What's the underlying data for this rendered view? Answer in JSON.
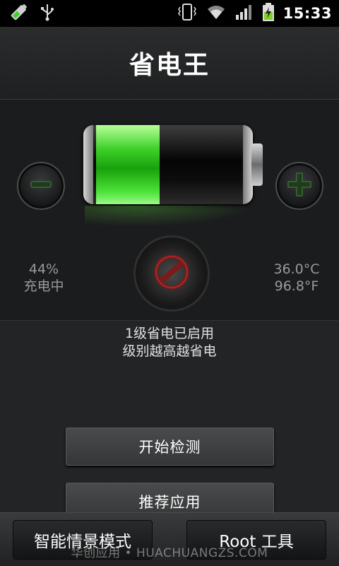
{
  "status_bar": {
    "time": "15:33",
    "icons": [
      "battery-app-icon",
      "usb-icon",
      "vibrate-icon",
      "wifi-icon",
      "signal-icon",
      "charging-battery-icon"
    ]
  },
  "header": {
    "title": "省电王"
  },
  "battery": {
    "level_fraction": 0.44,
    "percent_text": "44%",
    "state_text": "充电中",
    "temp_c": "36.0°C",
    "temp_f": "96.8°F",
    "fill_color": "#3fd12a"
  },
  "controls": {
    "minus_icon": "minus-icon",
    "plus_icon": "plus-icon",
    "power_icon": "no-entry-icon"
  },
  "status_message": {
    "line1": "1级省电已启用",
    "line2": "级别越高越省电"
  },
  "actions": {
    "start_check": "开始检测",
    "recommend_apps": "推荐应用"
  },
  "bottom_bar": {
    "smart_mode": "智能情景模式",
    "root_tools": "Root 工具"
  },
  "watermark": "华创应用 • HUACHUANGZS.COM"
}
